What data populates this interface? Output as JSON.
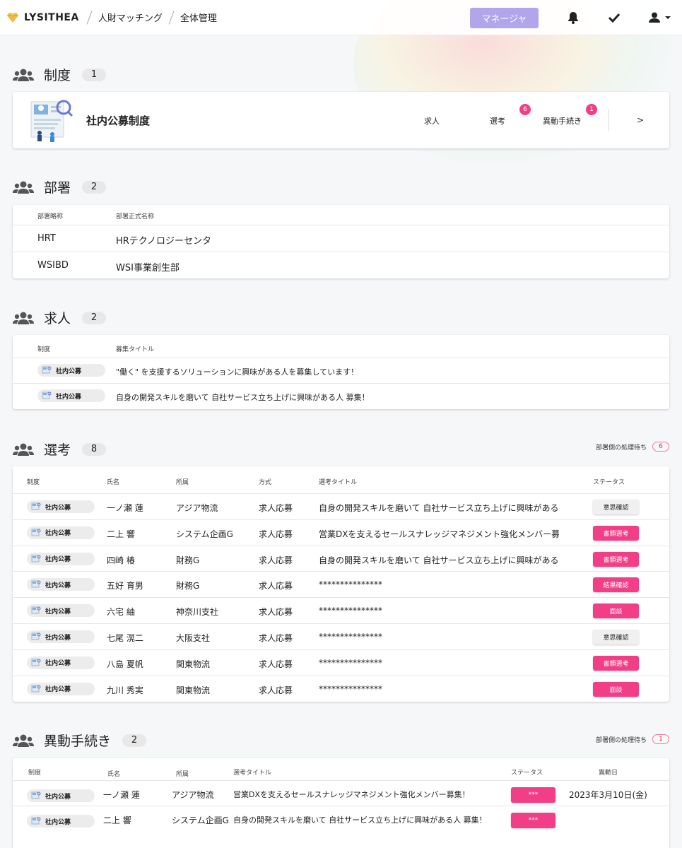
{
  "header": {
    "logo_text": "LYSITHEA",
    "breadcrumb": [
      "人財マッチング",
      "全体管理"
    ],
    "manager_button": "マネージャ",
    "icons": [
      "bell-icon",
      "check-icon",
      "user-icon"
    ]
  },
  "seido": {
    "title": "制度",
    "count": "1",
    "card": {
      "name": "社内公募制度",
      "tabs": {
        "kyujin": "求人",
        "senko": "選考",
        "senko_badge": "6",
        "ido": "異動手続き",
        "ido_badge": "1",
        "arrow": ">"
      }
    }
  },
  "busho": {
    "title": "部署",
    "count": "2",
    "headers": {
      "short": "部署略称",
      "full": "部署正式名称"
    },
    "rows": [
      {
        "short": "HRT",
        "full": "HRテクノロジーセンタ"
      },
      {
        "short": "WSIBD",
        "full": "WSI事業創生部"
      }
    ]
  },
  "kyujin": {
    "title": "求人",
    "count": "2",
    "headers": {
      "seido": "制度",
      "title": "募集タイトル"
    },
    "rows": [
      {
        "seido": "社内公募",
        "title": "\"働く\" を支援するソリューションに興味がある人を募集しています！"
      },
      {
        "seido": "社内公募",
        "title": "自身の開発スキルを磨いて 自社サービス立ち上げに興味がある人 募集！"
      }
    ]
  },
  "senko": {
    "title": "選考",
    "count": "8",
    "pending_label": "部署側の処理待ち",
    "pending_count": "6",
    "headers": {
      "seido": "制度",
      "name": "氏名",
      "dept": "所属",
      "method": "方式",
      "title": "選考タイトル",
      "status": "ステータス"
    },
    "rows": [
      {
        "seido": "社内公募",
        "name": "一ノ瀬 蓮",
        "dept": "アジア物流",
        "method": "求人応募",
        "title": "自身の開発スキルを磨いて 自社サービス立ち上げに興味がある人…",
        "status": "意思確認",
        "style": "gray"
      },
      {
        "seido": "社内公募",
        "name": "二上 響",
        "dept": "システム企画G",
        "method": "求人応募",
        "title": "営業DXを支えるセールスナレッジマネジメント強化メンバー募集！",
        "status": "書類選考",
        "style": "pink"
      },
      {
        "seido": "社内公募",
        "name": "四崎 椿",
        "dept": "財務G",
        "method": "求人応募",
        "title": "自身の開発スキルを磨いて 自社サービス立ち上げに興味がある人…",
        "status": "書類選考",
        "style": "pink"
      },
      {
        "seido": "社内公募",
        "name": "五好 育男",
        "dept": "財務G",
        "method": "求人応募",
        "title": "***************",
        "status": "結果確認",
        "style": "pink"
      },
      {
        "seido": "社内公募",
        "name": "六宅 紬",
        "dept": "神奈川支社",
        "method": "求人応募",
        "title": "***************",
        "status": "面談",
        "style": "pink"
      },
      {
        "seido": "社内公募",
        "name": "七尾 滉二",
        "dept": "大阪支社",
        "method": "求人応募",
        "title": "***************",
        "status": "意思確認",
        "style": "gray"
      },
      {
        "seido": "社内公募",
        "name": "八島 夏帆",
        "dept": "関東物流",
        "method": "求人応募",
        "title": "***************",
        "status": "書類選考",
        "style": "pink"
      },
      {
        "seido": "社内公募",
        "name": "九川 秀実",
        "dept": "関東物流",
        "method": "求人応募",
        "title": "***************",
        "status": "面談",
        "style": "pink"
      }
    ]
  },
  "ido": {
    "title": "異動手続き",
    "count": "2",
    "pending_label": "部署側の処理待ち",
    "pending_count": "1",
    "headers": {
      "seido": "制度",
      "name": "氏名",
      "dept": "所属",
      "title": "選考タイトル",
      "status": "ステータス",
      "date": "異動日"
    },
    "rows": [
      {
        "seido": "社内公募",
        "name": "一ノ瀬 蓮",
        "dept": "アジア物流",
        "title": "営業DXを支えるセールスナレッジマネジメント強化メンバー募集！",
        "status": "***",
        "date": "2023年3月10日(金)"
      },
      {
        "seido": "社内公募",
        "name": "二上 響",
        "dept": "システム企画G",
        "title": "自身の開発スキルを磨いて 自社サービス立ち上げに興味がある人 募集！",
        "status": "***",
        "date": ""
      }
    ]
  },
  "colors": {
    "accent_pink": "#f23e86",
    "manager_purple": "#b1a5ec"
  }
}
